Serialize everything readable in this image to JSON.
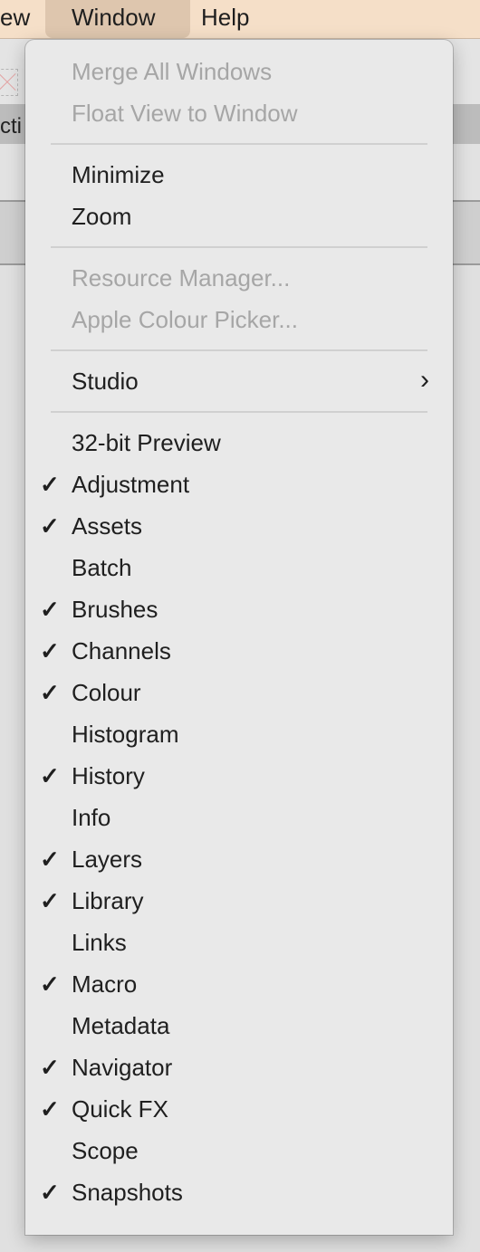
{
  "menubar": {
    "items": [
      {
        "label": "ew"
      },
      {
        "label": "Window",
        "active": true
      },
      {
        "label": "Help"
      }
    ]
  },
  "background": {
    "partial_label": "cti"
  },
  "colors": {
    "menubar_bg": "#f5dfc8",
    "menubar_active": "#dec6ae",
    "menu_bg": "#e9e9e9",
    "text": "#1f1f1f",
    "disabled_text": "#a6a6a6"
  },
  "window_menu": {
    "groups": [
      [
        {
          "label": "Merge All Windows",
          "enabled": false,
          "checked": false
        },
        {
          "label": "Float View to Window",
          "enabled": false,
          "checked": false
        }
      ],
      [
        {
          "label": "Minimize",
          "enabled": true,
          "checked": false
        },
        {
          "label": "Zoom",
          "enabled": true,
          "checked": false
        }
      ],
      [
        {
          "label": "Resource Manager...",
          "enabled": false,
          "checked": false
        },
        {
          "label": "Apple Colour Picker...",
          "enabled": false,
          "checked": false
        }
      ],
      [
        {
          "label": "Studio",
          "enabled": true,
          "checked": false,
          "submenu": true,
          "submenu_icon": "›"
        }
      ],
      [
        {
          "label": "32-bit Preview",
          "enabled": true,
          "checked": false
        },
        {
          "label": "Adjustment",
          "enabled": true,
          "checked": true
        },
        {
          "label": "Assets",
          "enabled": true,
          "checked": true
        },
        {
          "label": "Batch",
          "enabled": true,
          "checked": false
        },
        {
          "label": "Brushes",
          "enabled": true,
          "checked": true
        },
        {
          "label": "Channels",
          "enabled": true,
          "checked": true
        },
        {
          "label": "Colour",
          "enabled": true,
          "checked": true
        },
        {
          "label": "Histogram",
          "enabled": true,
          "checked": false
        },
        {
          "label": "History",
          "enabled": true,
          "checked": true
        },
        {
          "label": "Info",
          "enabled": true,
          "checked": false
        },
        {
          "label": "Layers",
          "enabled": true,
          "checked": true
        },
        {
          "label": "Library",
          "enabled": true,
          "checked": true
        },
        {
          "label": "Links",
          "enabled": true,
          "checked": false
        },
        {
          "label": "Macro",
          "enabled": true,
          "checked": true
        },
        {
          "label": "Metadata",
          "enabled": true,
          "checked": false
        },
        {
          "label": "Navigator",
          "enabled": true,
          "checked": true
        },
        {
          "label": "Quick FX",
          "enabled": true,
          "checked": true
        },
        {
          "label": "Scope",
          "enabled": true,
          "checked": false
        },
        {
          "label": "Snapshots",
          "enabled": true,
          "checked": true
        }
      ]
    ],
    "check_icon": "✓"
  }
}
